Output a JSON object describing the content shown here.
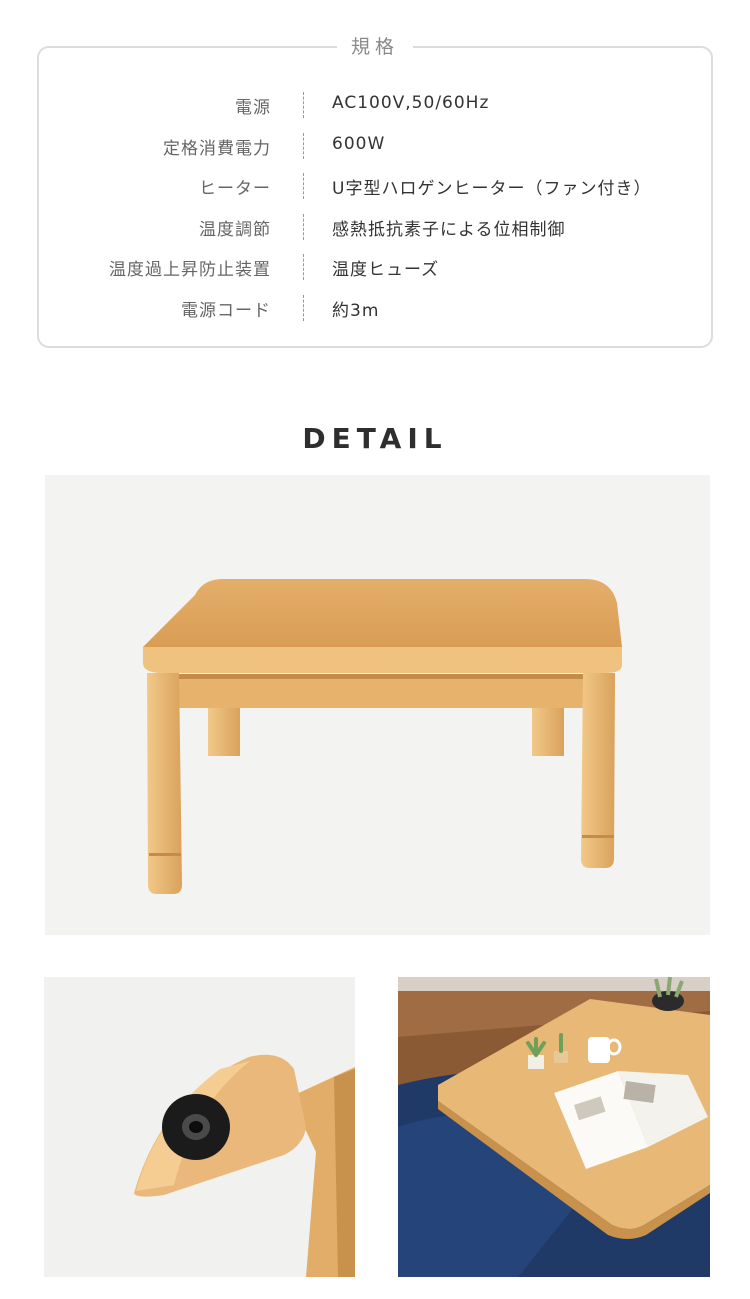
{
  "spec": {
    "title": "規格",
    "rows": [
      {
        "label": "電源",
        "value": "AC100V,50/60Hz"
      },
      {
        "label": "定格消費電力",
        "value": "600W"
      },
      {
        "label": "ヒーター",
        "value": "U字型ハロゲンヒーター（ファン付き）"
      },
      {
        "label": "温度調節",
        "value": "感熱抵抗素子による位相制御"
      },
      {
        "label": "温度過上昇防止装置",
        "value": "温度ヒューズ"
      },
      {
        "label": "電源コード",
        "value": "約3m"
      }
    ]
  },
  "detail": {
    "heading": "DETAIL"
  },
  "colors": {
    "wood": "#e8b877",
    "wood_dark": "#c8914c",
    "rug": "#1f3a66",
    "floor": "#8a5a34",
    "background": "#f3f3f1"
  }
}
